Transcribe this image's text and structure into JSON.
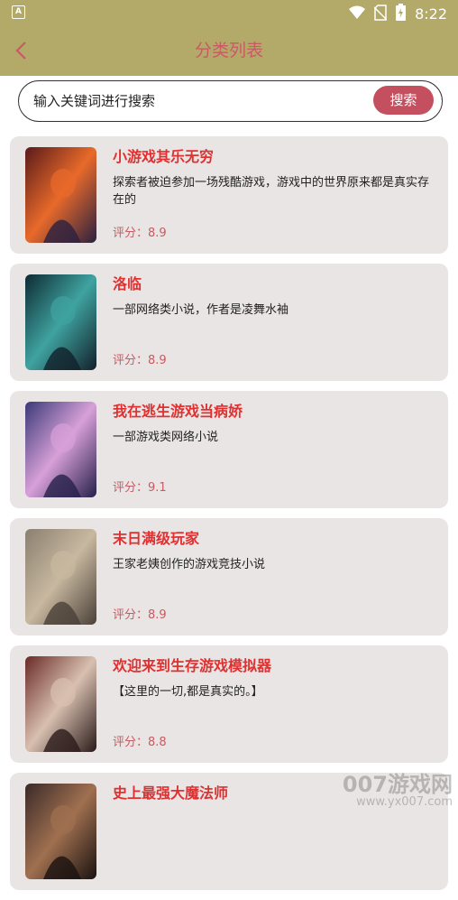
{
  "status_bar": {
    "left_badge": "A",
    "time": "8:22",
    "icons": [
      "wifi-icon",
      "sim-off-icon",
      "battery-charging-icon"
    ]
  },
  "header": {
    "title": "分类列表",
    "back_icon": "chevron-left-icon"
  },
  "search": {
    "placeholder": "输入关键词进行搜索",
    "button_label": "搜索"
  },
  "books": [
    {
      "title": "小游戏其乐无穷",
      "desc": "探索者被迫参加一场残酷游戏，游戏中的世界原来都是真实存在的",
      "score": "评分：8.9",
      "cover_colors": [
        "#5a1a1a",
        "#e86a2a",
        "#2a2040"
      ]
    },
    {
      "title": "洛临",
      "desc": "一部网络类小说，作者是凌舞水袖",
      "score": "评分：8.9",
      "cover_colors": [
        "#0e2a33",
        "#3fa3a0",
        "#12202a"
      ]
    },
    {
      "title": "我在逃生游戏当病娇",
      "desc": "一部游戏类网络小说",
      "score": "评分：9.1",
      "cover_colors": [
        "#3a3a78",
        "#d8a0d8",
        "#26204a"
      ]
    },
    {
      "title": "末日满级玩家",
      "desc": "王家老姨创作的游戏竞技小说",
      "score": "评分：8.9",
      "cover_colors": [
        "#8a8070",
        "#c8b8a0",
        "#4a4038"
      ]
    },
    {
      "title": "欢迎来到生存游戏模拟器",
      "desc": "【这里的一切,都是真实的。】",
      "score": "评分：8.8",
      "cover_colors": [
        "#6a2a28",
        "#d8c0b0",
        "#2a1a1a"
      ]
    },
    {
      "title": "史上最强大魔法师",
      "desc": "",
      "score": "",
      "cover_colors": [
        "#3a2a28",
        "#a07050",
        "#1a1210"
      ]
    }
  ],
  "watermark": {
    "text": "007游戏网",
    "sub": "www.yx007.com"
  }
}
